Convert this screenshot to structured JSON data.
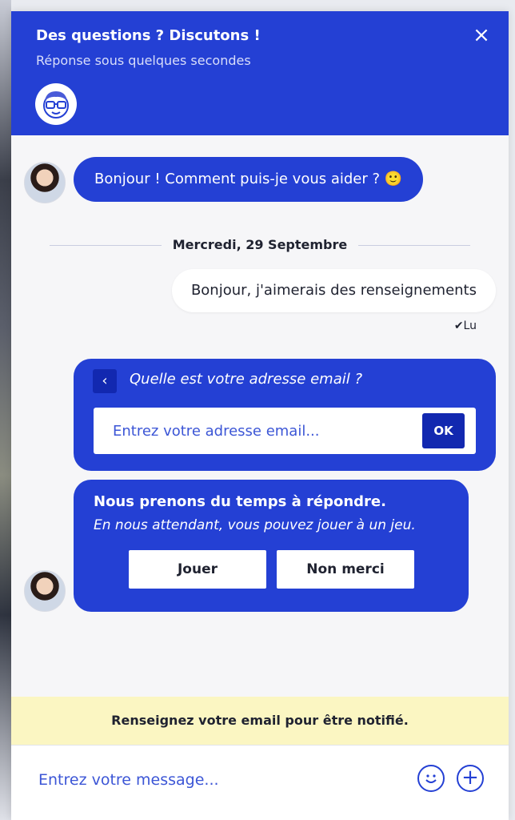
{
  "header": {
    "title": "Des questions ? Discutons !",
    "subtitle": "Réponse sous quelques secondes",
    "close_icon": "×"
  },
  "messages": {
    "agent_greeting": "Bonjour ! Comment puis-je vous aider ? 🙂",
    "date_separator": "Mercredi, 29 Septembre",
    "user_message": "Bonjour, j'aimerais des renseignements",
    "read_status": "✔Lu"
  },
  "email_card": {
    "back_icon": "‹",
    "question": "Quelle est votre adresse email ?",
    "placeholder": "Entrez votre adresse email...",
    "ok_label": "OK"
  },
  "game_card": {
    "title": "Nous prenons du temps à répondre.",
    "subtitle": "En nous attendant, vous pouvez jouer à un jeu.",
    "play_label": "Jouer",
    "no_thanks_label": "Non merci"
  },
  "notice": {
    "text": "Renseignez votre email pour être notifié."
  },
  "composer": {
    "placeholder": "Entrez votre message...",
    "plus_icon": "+"
  },
  "colors": {
    "primary": "#2440d4",
    "primary_dark": "#1228b0",
    "notice_bg": "#fbf6c2"
  }
}
